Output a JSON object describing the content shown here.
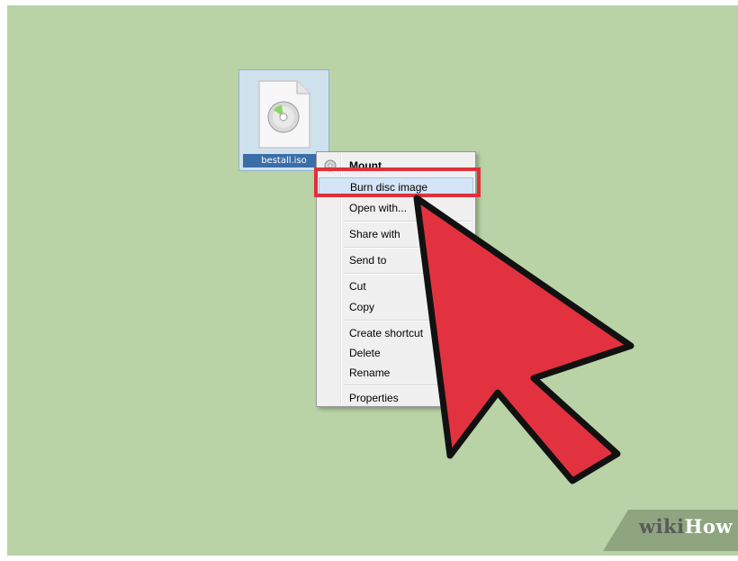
{
  "file": {
    "name": "bestall.iso",
    "icon": "disc-image-file-icon"
  },
  "context_menu": {
    "items": [
      {
        "label": "Mount",
        "bold": true,
        "icon": "disc-icon"
      },
      {
        "label": "Burn disc image",
        "highlighted": true
      },
      {
        "label": "Open with..."
      },
      {
        "label": "Share with"
      },
      {
        "label": "Send to"
      },
      {
        "label": "Cut"
      },
      {
        "label": "Copy"
      },
      {
        "label": "Create shortcut"
      },
      {
        "label": "Delete"
      },
      {
        "label": "Rename"
      },
      {
        "label": "Properties"
      }
    ]
  },
  "annotation": {
    "highlight_color": "#e0303a",
    "arrow_color": "#e23240"
  },
  "watermark": {
    "part1": "wiki",
    "part2": "How"
  },
  "colors": {
    "desktop": "#b9d3a6",
    "selection": "#d5e5f7"
  }
}
